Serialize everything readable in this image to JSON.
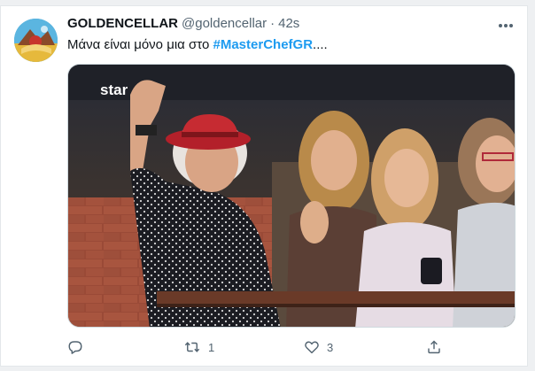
{
  "tweet": {
    "author": {
      "display_name": "GOLDENCELLAR",
      "handle": "@goldencellar",
      "avatar_icon": "profile-avatar"
    },
    "separator": "·",
    "time": "42s",
    "text_prefix": "Μάνα είναι μόνο μια στο ",
    "hashtag": "#MasterChefGR",
    "text_suffix": "....",
    "media": {
      "watermark": "star"
    },
    "actions": {
      "reply": {
        "icon": "reply-icon"
      },
      "retweet": {
        "icon": "retweet-icon",
        "count": "1"
      },
      "like": {
        "icon": "heart-icon",
        "count": "3"
      },
      "share": {
        "icon": "share-icon"
      }
    },
    "more_icon": "more-horizontal-icon"
  },
  "colors": {
    "link": "#1d9bf0",
    "text_primary": "#0f1419",
    "text_secondary": "#536471",
    "background": "#eef0f2"
  }
}
